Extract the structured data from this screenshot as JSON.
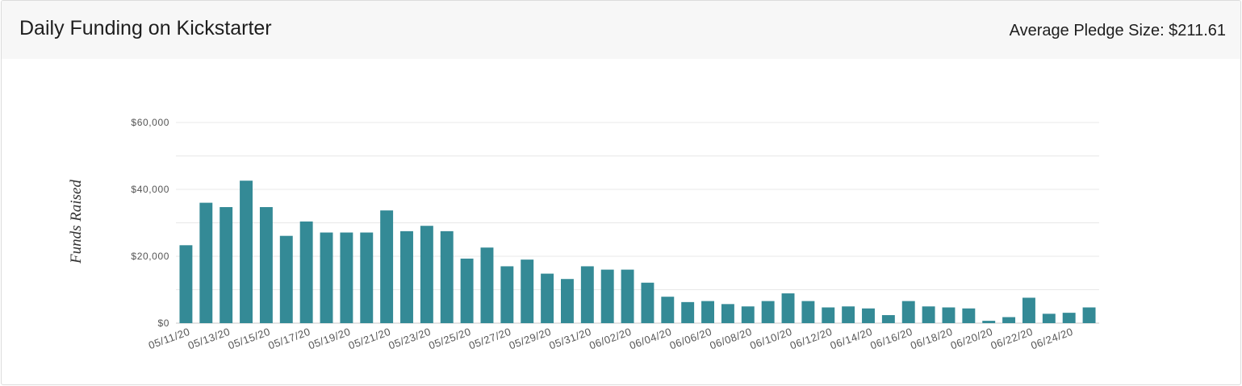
{
  "header": {
    "title": "Daily Funding on Kickstarter",
    "avg_pledge": "Average Pledge Size: $211.61"
  },
  "colors": {
    "bar": "#348a96",
    "grid": "#e8e8e8",
    "axis_text": "#555555",
    "header_bg": "#f7f7f7"
  },
  "chart_data": {
    "type": "bar",
    "ylabel": "Funds Raised",
    "xlabel": "",
    "ylim": [
      0,
      60000
    ],
    "y_ticks": [
      0,
      20000,
      40000,
      60000
    ],
    "y_tick_labels": [
      "$0",
      "$20,000",
      "$40,000",
      "$60,000"
    ],
    "grid": true,
    "x_tick_labels": [
      "05/11/20",
      "05/13/20",
      "05/15/20",
      "05/17/20",
      "05/19/20",
      "05/21/20",
      "05/23/20",
      "05/25/20",
      "05/27/20",
      "05/29/20",
      "05/31/20",
      "06/02/20",
      "06/04/20",
      "06/06/20",
      "06/08/20",
      "06/10/20",
      "06/12/20",
      "06/14/20",
      "06/16/20",
      "06/18/20",
      "06/20/20",
      "06/22/20",
      "06/24/20"
    ],
    "categories": [
      "05/11/20",
      "05/12/20",
      "05/13/20",
      "05/14/20",
      "05/15/20",
      "05/16/20",
      "05/17/20",
      "05/18/20",
      "05/19/20",
      "05/20/20",
      "05/21/20",
      "05/22/20",
      "05/23/20",
      "05/24/20",
      "05/25/20",
      "05/26/20",
      "05/27/20",
      "05/28/20",
      "05/29/20",
      "05/30/20",
      "05/31/20",
      "06/01/20",
      "06/02/20",
      "06/03/20",
      "06/04/20",
      "06/05/20",
      "06/06/20",
      "06/07/20",
      "06/08/20",
      "06/09/20",
      "06/10/20",
      "06/11/20",
      "06/12/20",
      "06/13/20",
      "06/14/20",
      "06/15/20",
      "06/16/20",
      "06/17/20",
      "06/18/20",
      "06/19/20",
      "06/20/20",
      "06/21/20",
      "06/22/20",
      "06/23/20",
      "06/24/20",
      "06/25/20"
    ],
    "values": [
      23300,
      36000,
      34700,
      42600,
      34700,
      26100,
      30400,
      27100,
      27100,
      27100,
      33700,
      27500,
      29100,
      27500,
      19300,
      22600,
      17000,
      19000,
      14800,
      13200,
      17000,
      16000,
      16000,
      12100,
      7900,
      6300,
      6600,
      5700,
      5000,
      6600,
      8900,
      6600,
      4700,
      5000,
      4400,
      2400,
      6600,
      5000,
      4700,
      4400,
      700,
      1800,
      7600,
      2800,
      3100,
      4700
    ]
  }
}
